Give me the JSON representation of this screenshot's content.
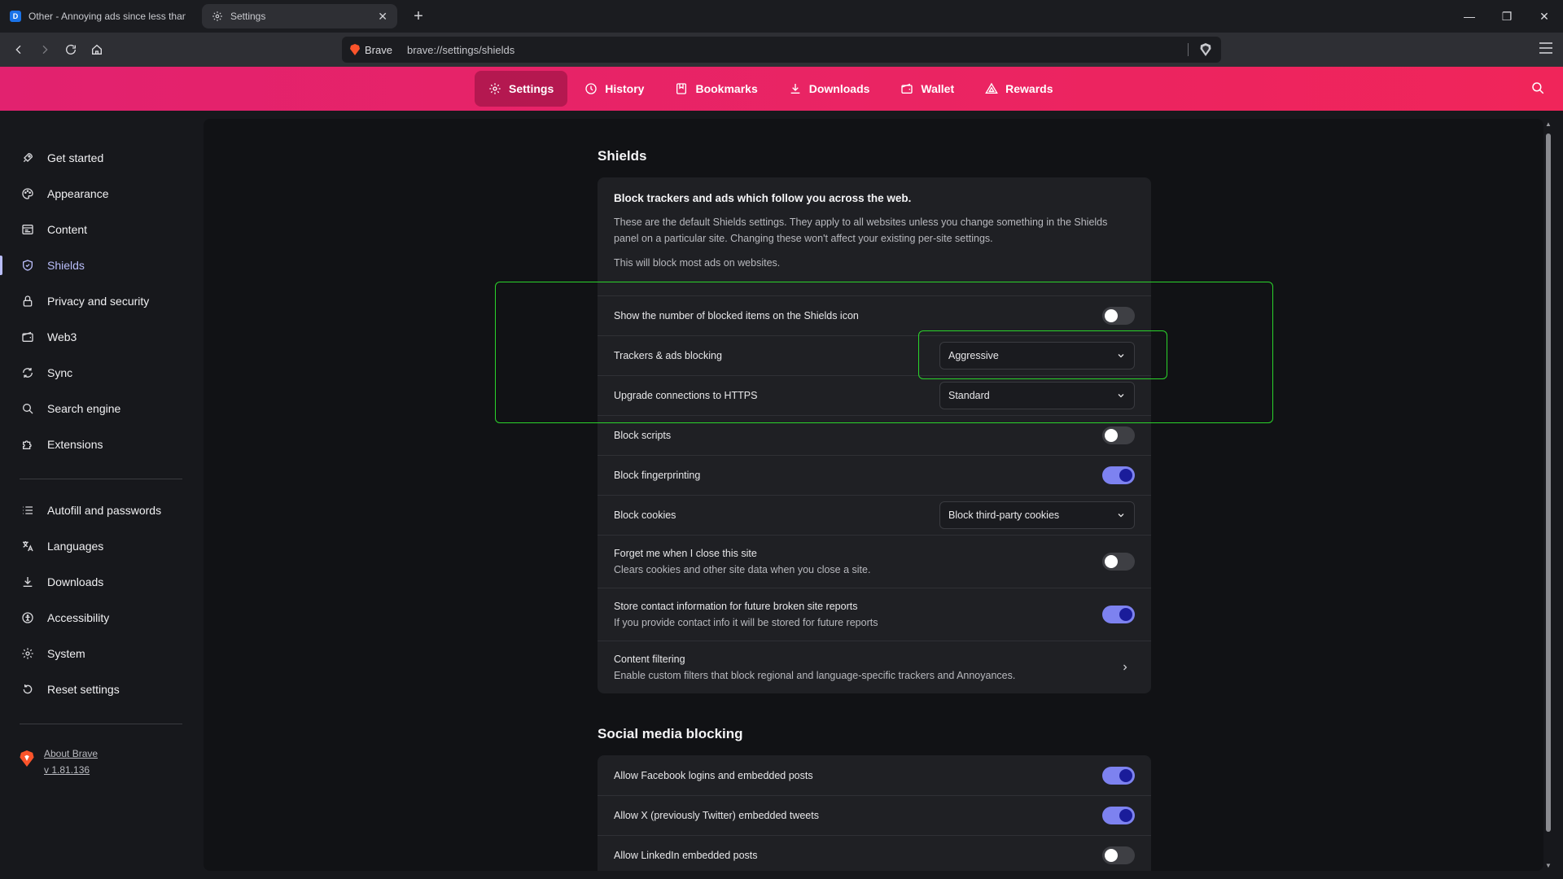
{
  "tabs": [
    {
      "title": "Other - Annoying ads since less than",
      "active": false
    },
    {
      "title": "Settings",
      "active": true
    }
  ],
  "toolbar": {
    "site_name": "Brave",
    "url": "brave://settings/shields"
  },
  "topnav": [
    {
      "label": "Settings",
      "icon": "gear-icon",
      "active": true
    },
    {
      "label": "History",
      "icon": "history-icon",
      "active": false
    },
    {
      "label": "Bookmarks",
      "icon": "bookmark-icon",
      "active": false
    },
    {
      "label": "Downloads",
      "icon": "download-icon",
      "active": false
    },
    {
      "label": "Wallet",
      "icon": "wallet-icon",
      "active": false
    },
    {
      "label": "Rewards",
      "icon": "rewards-icon",
      "active": false
    }
  ],
  "sidebar": {
    "items": [
      {
        "label": "Get started",
        "icon": "rocket-icon"
      },
      {
        "label": "Appearance",
        "icon": "palette-icon"
      },
      {
        "label": "Content",
        "icon": "content-icon"
      },
      {
        "label": "Shields",
        "icon": "shield-icon",
        "active": true
      },
      {
        "label": "Privacy and security",
        "icon": "lock-icon"
      },
      {
        "label": "Web3",
        "icon": "wallet-icon"
      },
      {
        "label": "Sync",
        "icon": "sync-icon"
      },
      {
        "label": "Search engine",
        "icon": "search-icon"
      },
      {
        "label": "Extensions",
        "icon": "puzzle-icon"
      },
      {
        "label": "Autofill and passwords",
        "icon": "list-icon"
      },
      {
        "label": "Languages",
        "icon": "translate-icon"
      },
      {
        "label": "Downloads",
        "icon": "download-icon"
      },
      {
        "label": "Accessibility",
        "icon": "accessibility-icon"
      },
      {
        "label": "System",
        "icon": "gear-icon"
      },
      {
        "label": "Reset settings",
        "icon": "reset-icon"
      }
    ],
    "about_label": "About Brave",
    "version": "v 1.81.136"
  },
  "shields": {
    "title": "Shields",
    "heading": "Block trackers and ads which follow you across the web.",
    "description": "These are the default Shields settings. They apply to all websites unless you change something in the Shields panel on a particular site. Changing these won't affect your existing per-site settings.",
    "note": "This will block most ads on websites.",
    "rows": [
      {
        "label": "Show the number of blocked items on the Shields icon",
        "control": "toggle",
        "on": false
      },
      {
        "label": "Trackers & ads blocking",
        "control": "select",
        "value": "Aggressive"
      },
      {
        "label": "Upgrade connections to HTTPS",
        "control": "select",
        "value": "Standard"
      },
      {
        "label": "Block scripts",
        "control": "toggle",
        "on": false
      },
      {
        "label": "Block fingerprinting",
        "control": "toggle",
        "on": true
      },
      {
        "label": "Block cookies",
        "control": "select",
        "value": "Block third-party cookies"
      },
      {
        "label": "Forget me when I close this site",
        "sub": "Clears cookies and other site data when you close a site.",
        "control": "toggle",
        "on": false
      },
      {
        "label": "Store contact information for future broken site reports",
        "sub": "If you provide contact info it will be stored for future reports",
        "control": "toggle",
        "on": true
      },
      {
        "label": "Content filtering",
        "sub": "Enable custom filters that block regional and language-specific trackers and Annoyances.",
        "control": "link"
      }
    ]
  },
  "social": {
    "title": "Social media blocking",
    "rows": [
      {
        "label": "Allow Facebook logins and embedded posts",
        "on": true
      },
      {
        "label": "Allow X (previously Twitter) embedded tweets",
        "on": true
      },
      {
        "label": "Allow LinkedIn embedded posts",
        "on": false
      }
    ]
  },
  "colors": {
    "header_gradient_start": "#e2226f",
    "header_gradient_end": "#f0255a",
    "accent": "#7d82f0",
    "highlight": "#2bd42b"
  }
}
